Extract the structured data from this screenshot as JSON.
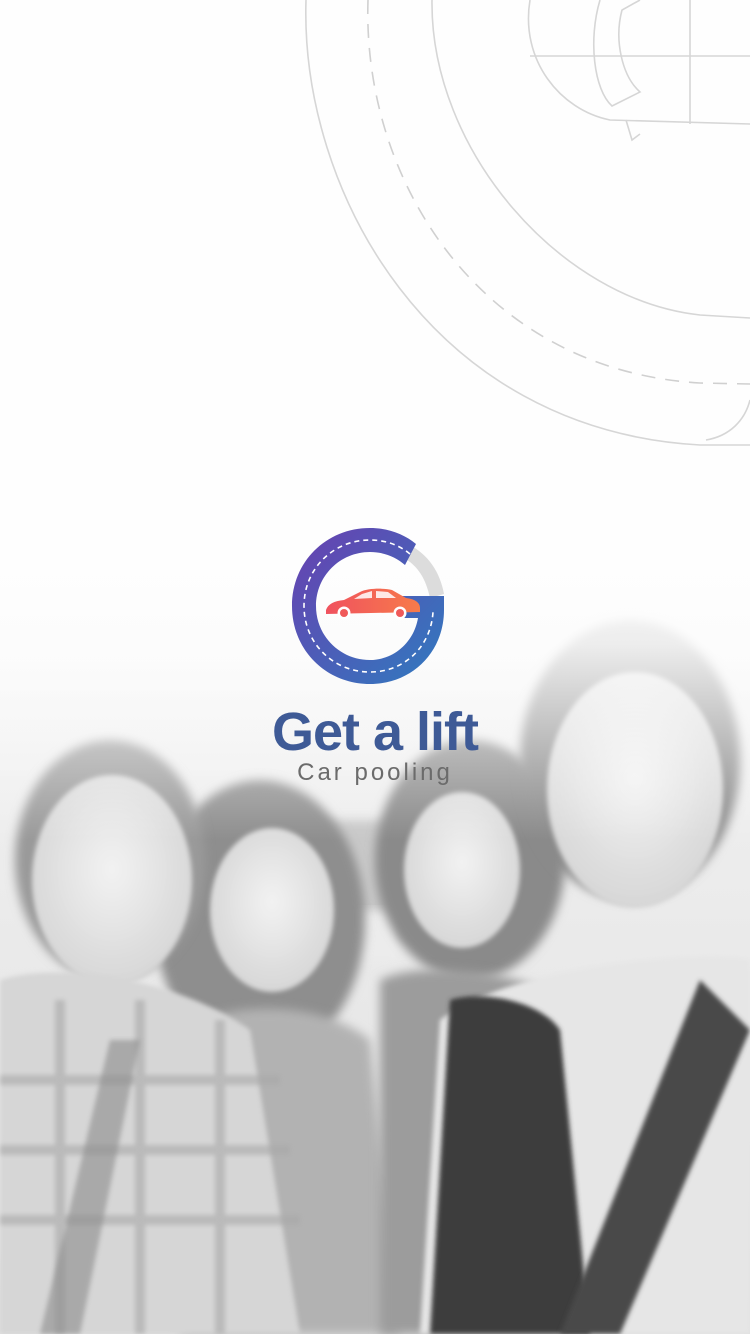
{
  "app": {
    "title": "Get a lift",
    "subtitle": "Car pooling"
  },
  "logo": {
    "icon": "g-road-car-logo",
    "gradient_start": "#6a3fb0",
    "gradient_end": "#2f7bbf",
    "car_gradient_start": "#f0525f",
    "car_gradient_end": "#f77b4a"
  },
  "colors": {
    "title": "#3e5a96",
    "subtitle": "#6b6b6b",
    "background": "#fefefe",
    "line_art": "#d4d4d4"
  },
  "background": {
    "image": "group-of-friends-photo",
    "art": "road-line-art"
  }
}
